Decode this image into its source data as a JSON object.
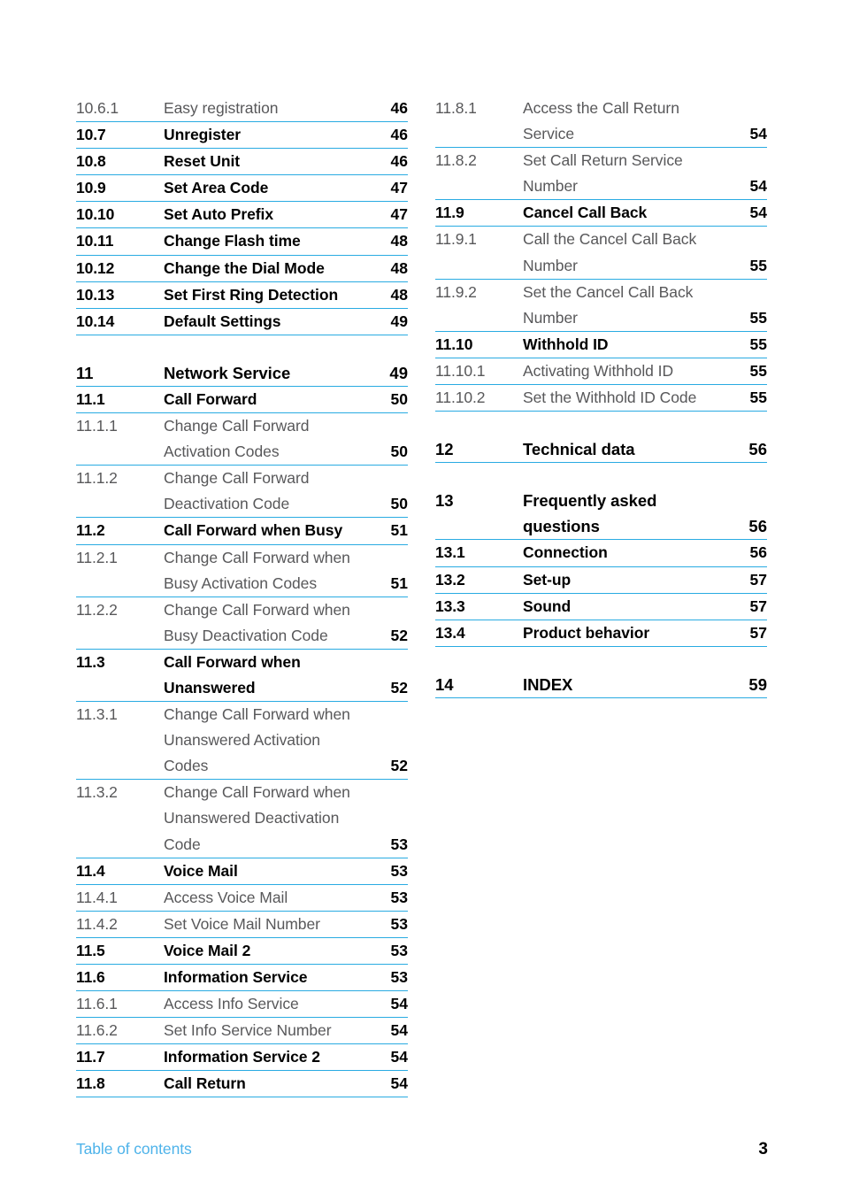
{
  "document": {
    "footer_label": "Table of contents",
    "page_number": "3",
    "rule_color": "#29abe2",
    "accent_color": "#4eb3ea",
    "subsection_color": "#58585a",
    "text_color": "#010101"
  },
  "columns": [
    {
      "name": "left-column",
      "groups": [
        {
          "gap_before": false,
          "entries": [
            {
              "number": "10.6.1",
              "level": "sub",
              "lines": [
                "Easy registration"
              ],
              "page": "46"
            },
            {
              "number": "10.7",
              "level": "sec",
              "lines": [
                "Unregister"
              ],
              "page": "46"
            },
            {
              "number": "10.8",
              "level": "sec",
              "lines": [
                "Reset Unit"
              ],
              "page": "46"
            },
            {
              "number": "10.9",
              "level": "sec",
              "lines": [
                "Set Area Code"
              ],
              "page": "47"
            },
            {
              "number": "10.10",
              "level": "sec",
              "lines": [
                "Set Auto Prefix"
              ],
              "page": "47"
            },
            {
              "number": "10.11",
              "level": "sec",
              "lines": [
                "Change Flash time"
              ],
              "page": "48"
            },
            {
              "number": "10.12",
              "level": "sec",
              "lines": [
                "Change the Dial Mode"
              ],
              "page": "48"
            },
            {
              "number": "10.13",
              "level": "sec",
              "lines": [
                "Set First Ring Detection"
              ],
              "page": "48"
            },
            {
              "number": "10.14",
              "level": "sec",
              "lines": [
                "Default Settings"
              ],
              "page": "49"
            }
          ]
        },
        {
          "gap_before": true,
          "entries": [
            {
              "number": "11",
              "level": "chap",
              "lines": [
                "Network Service"
              ],
              "page": "49"
            },
            {
              "number": "11.1",
              "level": "sec",
              "lines": [
                "Call Forward"
              ],
              "page": "50"
            },
            {
              "number": "11.1.1",
              "level": "sub",
              "lines": [
                "Change Call Forward",
                "Activation Codes"
              ],
              "page": "50"
            },
            {
              "number": "11.1.2",
              "level": "sub",
              "lines": [
                "Change Call Forward",
                "Deactivation Code"
              ],
              "page": "50"
            },
            {
              "number": "11.2",
              "level": "sec",
              "lines": [
                "Call Forward when Busy"
              ],
              "page": "51"
            },
            {
              "number": "11.2.1",
              "level": "sub",
              "lines": [
                "Change Call Forward when",
                "Busy Activation Codes"
              ],
              "page": "51"
            },
            {
              "number": "11.2.2",
              "level": "sub",
              "lines": [
                "Change Call Forward when",
                "Busy Deactivation Code"
              ],
              "page": "52"
            },
            {
              "number": "11.3",
              "level": "sec",
              "lines": [
                "Call Forward when",
                "Unanswered"
              ],
              "page": "52"
            },
            {
              "number": "11.3.1",
              "level": "sub",
              "lines": [
                "Change Call Forward when",
                "Unanswered Activation",
                "Codes"
              ],
              "page": "52"
            },
            {
              "number": "11.3.2",
              "level": "sub",
              "lines": [
                "Change Call Forward when",
                "Unanswered Deactivation",
                "Code"
              ],
              "page": "53"
            },
            {
              "number": "11.4",
              "level": "sec",
              "lines": [
                "Voice Mail"
              ],
              "page": "53"
            },
            {
              "number": "11.4.1",
              "level": "sub",
              "lines": [
                "Access Voice Mail"
              ],
              "page": "53"
            },
            {
              "number": "11.4.2",
              "level": "sub",
              "lines": [
                "Set Voice Mail Number"
              ],
              "page": "53"
            },
            {
              "number": "11.5",
              "level": "sec",
              "lines": [
                "Voice Mail 2"
              ],
              "page": "53"
            },
            {
              "number": "11.6",
              "level": "sec",
              "lines": [
                "Information Service"
              ],
              "page": "53"
            },
            {
              "number": "11.6.1",
              "level": "sub",
              "lines": [
                "Access Info Service"
              ],
              "page": "54"
            },
            {
              "number": "11.6.2",
              "level": "sub",
              "lines": [
                "Set Info Service Number"
              ],
              "page": "54"
            },
            {
              "number": "11.7",
              "level": "sec",
              "lines": [
                "Information Service 2"
              ],
              "page": "54"
            },
            {
              "number": "11.8",
              "level": "sec",
              "lines": [
                "Call Return"
              ],
              "page": "54"
            }
          ]
        }
      ]
    },
    {
      "name": "right-column",
      "groups": [
        {
          "gap_before": false,
          "entries": [
            {
              "number": "11.8.1",
              "level": "sub",
              "lines": [
                "Access the Call Return",
                "Service"
              ],
              "page": "54"
            },
            {
              "number": "11.8.2",
              "level": "sub",
              "lines": [
                "Set Call Return Service",
                "Number"
              ],
              "page": "54"
            },
            {
              "number": "11.9",
              "level": "sec",
              "lines": [
                "Cancel Call Back"
              ],
              "page": "54"
            },
            {
              "number": "11.9.1",
              "level": "sub",
              "lines": [
                "Call the Cancel Call Back",
                "Number"
              ],
              "page": "55"
            },
            {
              "number": "11.9.2",
              "level": "sub",
              "lines": [
                "Set the Cancel Call Back",
                "Number"
              ],
              "page": "55"
            },
            {
              "number": "11.10",
              "level": "sec",
              "lines": [
                "Withhold ID"
              ],
              "page": "55"
            },
            {
              "number": "11.10.1",
              "level": "sub",
              "lines": [
                "Activating Withhold ID"
              ],
              "page": "55"
            },
            {
              "number": "11.10.2",
              "level": "sub",
              "lines": [
                "Set the Withhold ID Code"
              ],
              "page": "55"
            }
          ]
        },
        {
          "gap_before": true,
          "entries": [
            {
              "number": "12",
              "level": "chap",
              "lines": [
                "Technical data"
              ],
              "page": "56"
            }
          ]
        },
        {
          "gap_before": true,
          "entries": [
            {
              "number": "13",
              "level": "chap",
              "lines": [
                "Frequently asked",
                "questions"
              ],
              "page": "56"
            },
            {
              "number": "13.1",
              "level": "sec",
              "lines": [
                "Connection"
              ],
              "page": "56"
            },
            {
              "number": "13.2",
              "level": "sec",
              "lines": [
                "Set-up"
              ],
              "page": "57"
            },
            {
              "number": "13.3",
              "level": "sec",
              "lines": [
                "Sound"
              ],
              "page": "57"
            },
            {
              "number": "13.4",
              "level": "sec",
              "lines": [
                "Product behavior"
              ],
              "page": "57"
            }
          ]
        },
        {
          "gap_before": true,
          "entries": [
            {
              "number": "14",
              "level": "chap",
              "lines": [
                "INDEX"
              ],
              "page": "59"
            }
          ]
        }
      ]
    }
  ]
}
